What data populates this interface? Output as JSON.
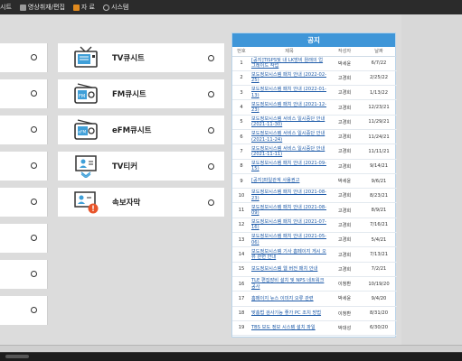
{
  "menu": {
    "items": [
      {
        "label": "시트",
        "icon": "partial-icon",
        "color": "#2b2b2b"
      },
      {
        "label": "영상취재/편집",
        "icon": "video-icon",
        "color": "#888888"
      },
      {
        "label": "자 료",
        "icon": "folder-icon",
        "color": "#e08a1e"
      },
      {
        "label": "시스템",
        "icon": "gear-icon",
        "color": "#aaaaaa"
      }
    ]
  },
  "cards": [
    {
      "label": "TV큐시트",
      "icon": "tv-cuesheet-icon"
    },
    {
      "label": "FM큐시트",
      "icon": "fm-cuesheet-icon"
    },
    {
      "label": "eFM큐시트",
      "icon": "efm-cuesheet-icon"
    },
    {
      "label": "TV티커",
      "icon": "tv-ticker-icon"
    },
    {
      "label": "속보자막",
      "icon": "breaking-caption-icon"
    }
  ],
  "notice": {
    "title": "공지",
    "columns": [
      "번호",
      "제목",
      "작성자",
      "날짜"
    ],
    "rows": [
      {
        "no": "1",
        "title": "[공지]TISPS및 내 LK방비 원래의 업 그레이드 작업",
        "author": "박세윤",
        "date": "6/7/22"
      },
      {
        "no": "2",
        "title": "보도정보시스템 패치 안내 (2022-02-25)",
        "author": "고경희",
        "date": "2/25/22"
      },
      {
        "no": "3",
        "title": "보도정보시스템 패치 안내 (2022-01-13)",
        "author": "고경희",
        "date": "1/13/22"
      },
      {
        "no": "4",
        "title": "보도정보시스템 패치 안내 (2021-12-23)",
        "author": "고경희",
        "date": "12/23/21"
      },
      {
        "no": "5",
        "title": "보도정보시스템 서비스 일시중단 안내 (2021-11-30)",
        "author": "고경희",
        "date": "11/29/21"
      },
      {
        "no": "6",
        "title": "보도정보시스템 서비스 일시중단 안내 (2021-11-24)",
        "author": "고경희",
        "date": "11/24/21"
      },
      {
        "no": "7",
        "title": "보도정보시스템 서비스 일시중단 안내 (2021-11-11)",
        "author": "고경희",
        "date": "11/11/21"
      },
      {
        "no": "8",
        "title": "보도정보시스템 패치 안내 (2021-09-15)",
        "author": "고경희",
        "date": "9/14/21"
      },
      {
        "no": "9",
        "title": "[공지]파일관계 사용권고",
        "author": "박세윤",
        "date": "9/6/21"
      },
      {
        "no": "10",
        "title": "보도정보시스템 패치 안내 (2021-08-23)",
        "author": "고경희",
        "date": "8/23/21"
      },
      {
        "no": "11",
        "title": "보도정보시스템 패치 안내 (2021-08-09)",
        "author": "고경희",
        "date": "8/9/21"
      },
      {
        "no": "12",
        "title": "보도정보시스템 패치 안내 (2021-07-16)",
        "author": "고경희",
        "date": "7/16/21"
      },
      {
        "no": "13",
        "title": "보도정보시스템 패치 안내 (2021-05-06)",
        "author": "고경희",
        "date": "5/4/21"
      },
      {
        "no": "14",
        "title": "보도정보시스템 기사 홈페이지 게시 오류 관련 안내",
        "author": "고경희",
        "date": "7/13/21"
      },
      {
        "no": "15",
        "title": "보도정보시스템 웹 버전 패치 안내",
        "author": "고경희",
        "date": "7/2/21"
      },
      {
        "no": "16",
        "title": "TLE 편집장비 설치 및 NPS 네트워크 공사",
        "author": "이청환",
        "date": "10/19/20"
      },
      {
        "no": "17",
        "title": "홈페이지 뉴스 이미지 오류 관련",
        "author": "박세윤",
        "date": "9/4/20"
      },
      {
        "no": "18",
        "title": "맞춤법 검사기능 좋가 PC 조치 방법",
        "author": "이청환",
        "date": "8/31/20"
      },
      {
        "no": "19",
        "title": "TBS 보도 정보 시스템 설치 파일",
        "author": "박대성",
        "date": "6/30/20"
      }
    ]
  }
}
